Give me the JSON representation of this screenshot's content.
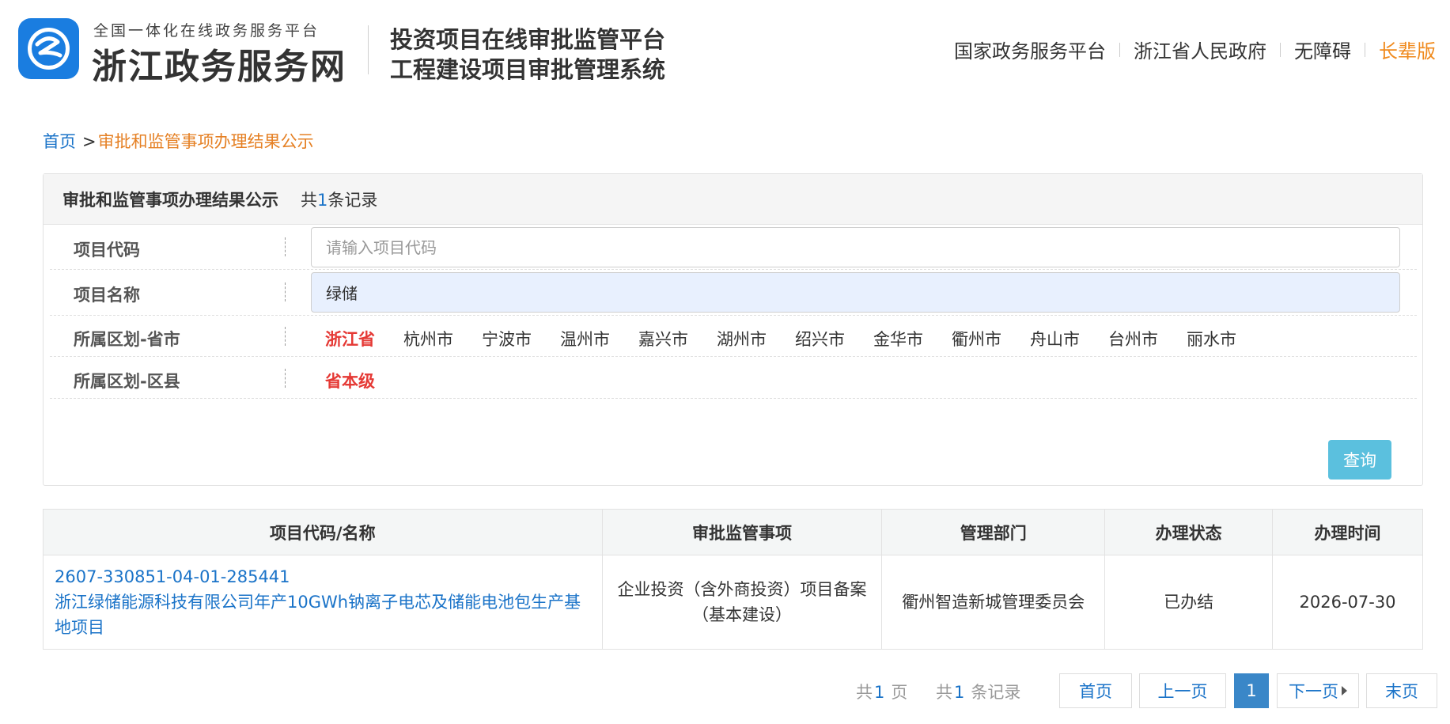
{
  "header": {
    "site_slogan": "全国一体化在线政务服务平台",
    "site_name": "浙江政务服务网",
    "system_title_1": "投资项目在线审批监管平台",
    "system_title_2": "工程建设项目审批管理系统",
    "links": [
      "国家政务服务平台",
      "浙江省人民政府",
      "无障碍",
      "长辈版"
    ]
  },
  "breadcrumb": {
    "home": "首页",
    "separator": ">",
    "current": "审批和监管事项办理结果公示"
  },
  "panel": {
    "title": "审批和监管事项办理结果公示",
    "count_prefix": "共",
    "count": "1",
    "count_suffix": "条记录"
  },
  "filters": {
    "project_code": {
      "label": "项目代码",
      "placeholder": "请输入项目代码",
      "value": ""
    },
    "project_name": {
      "label": "项目名称",
      "value": "绿储"
    },
    "city": {
      "label": "所属区划-省市",
      "options": [
        "浙江省",
        "杭州市",
        "宁波市",
        "温州市",
        "嘉兴市",
        "湖州市",
        "绍兴市",
        "金华市",
        "衢州市",
        "舟山市",
        "台州市",
        "丽水市"
      ],
      "selected": "浙江省"
    },
    "county": {
      "label": "所属区划-区县",
      "options": [
        "省本级"
      ],
      "selected": "省本级"
    },
    "query_label": "查询"
  },
  "table": {
    "columns": [
      "项目代码/名称",
      "审批监管事项",
      "管理部门",
      "办理状态",
      "办理时间"
    ],
    "rows": [
      {
        "code": "2607-330851-04-01-285441",
        "name": "浙江绿储能源科技有限公司年产10GWh钠离子电芯及储能电池包生产基地项目",
        "item": "企业投资（含外商投资）项目备案（基本建设）",
        "department": "衢州智造新城管理委员会",
        "status": "已办结",
        "date": "2026-07-30"
      }
    ]
  },
  "pagination": {
    "total_pages_prefix": "共",
    "total_pages": "1",
    "total_pages_suffix": "页",
    "total_records_prefix": "共",
    "total_records": "1",
    "total_records_suffix": "条记录",
    "first": "首页",
    "prev": "上一页",
    "current": "1",
    "next": "下一页",
    "last": "末页"
  },
  "colors": {
    "link_blue": "#1a73c8",
    "breadcrumb_orange": "#e58024",
    "elder_orange": "#f08a1d",
    "active_red": "#e53935",
    "query_button": "#5bc0de",
    "logo_blue": "#1a7de0"
  }
}
